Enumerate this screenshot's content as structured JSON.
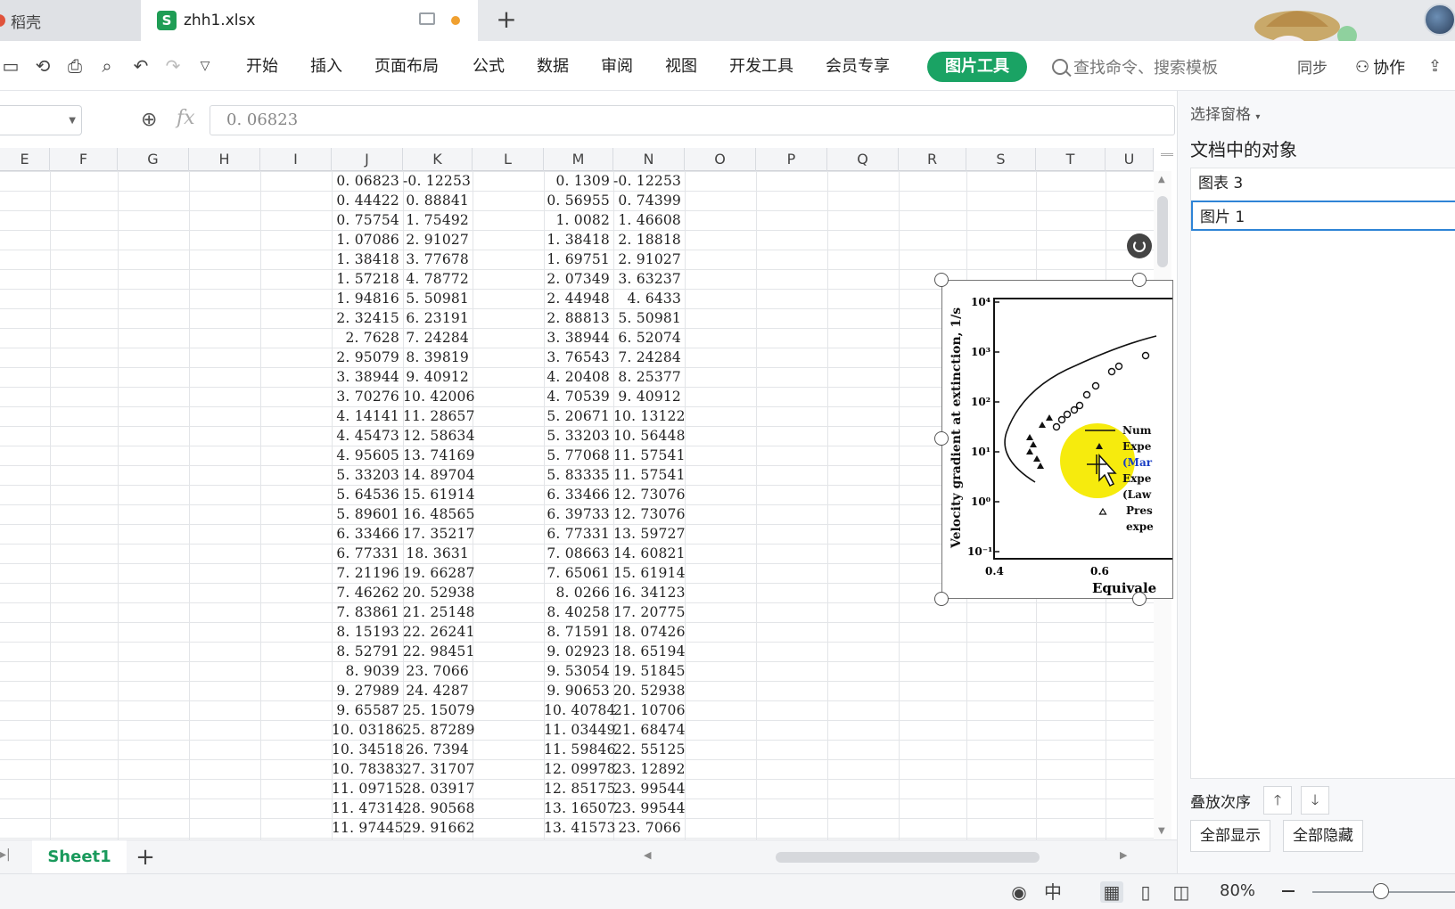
{
  "tabs": {
    "other_tab": "稻壳",
    "file_tab": "zhh1.xlsx",
    "file_badge": "S"
  },
  "ribbon": {
    "menu": [
      "开始",
      "插入",
      "页面布局",
      "公式",
      "数据",
      "审阅",
      "视图",
      "开发工具",
      "会员专享"
    ],
    "active_tool": "图片工具",
    "search_placeholder": "查找命令、搜索模板",
    "sync_label": "同步",
    "collab_label": "协作"
  },
  "formula_bar": {
    "fx_label": "fx",
    "value": "0. 06823"
  },
  "columns": [
    "E",
    "F",
    "G",
    "H",
    "I",
    "J",
    "K",
    "L",
    "M",
    "N",
    "O",
    "P",
    "Q",
    "R",
    "S",
    "T",
    "U"
  ],
  "table": {
    "J": [
      "0. 06823",
      "0. 44422",
      "0. 75754",
      "1. 07086",
      "1. 38418",
      "1. 57218",
      "1. 94816",
      "2. 32415",
      "2. 7628",
      "2. 95079",
      "3. 38944",
      "3. 70276",
      "4. 14141",
      "4. 45473",
      "4. 95605",
      "5. 33203",
      "5. 64536",
      "5. 89601",
      "6. 33466",
      "6. 77331",
      "7. 21196",
      "7. 46262",
      "7. 83861",
      "8. 15193",
      "8. 52791",
      "8. 9039",
      "9. 27989",
      "9. 65587",
      "10. 03186",
      "10. 34518",
      "10. 78383",
      "11. 09715",
      "11. 47314",
      "11. 97445"
    ],
    "K": [
      "-0. 12253",
      "0. 88841",
      "1. 75492",
      "2. 91027",
      "3. 77678",
      "4. 78772",
      "5. 50981",
      "6. 23191",
      "7. 24284",
      "8. 39819",
      "9. 40912",
      "10. 42006",
      "11. 28657",
      "12. 58634",
      "13. 74169",
      "14. 89704",
      "15. 61914",
      "16. 48565",
      "17. 35217",
      "18. 3631",
      "19. 66287",
      "20. 52938",
      "21. 25148",
      "22. 26241",
      "22. 98451",
      "23. 7066",
      "24. 4287",
      "25. 15079",
      "25. 87289",
      "26. 7394",
      "27. 31707",
      "28. 03917",
      "28. 90568",
      "29. 91662"
    ],
    "M": [
      "0. 1309",
      "0. 56955",
      "1. 0082",
      "1. 38418",
      "1. 69751",
      "2. 07349",
      "2. 44948",
      "2. 88813",
      "3. 38944",
      "3. 76543",
      "4. 20408",
      "4. 70539",
      "5. 20671",
      "5. 33203",
      "5. 77068",
      "5. 83335",
      "6. 33466",
      "6. 39733",
      "6. 77331",
      "7. 08663",
      "7. 65061",
      "8. 0266",
      "8. 40258",
      "8. 71591",
      "9. 02923",
      "9. 53054",
      "9. 90653",
      "10. 40784",
      "11. 03449",
      "11. 59846",
      "12. 09978",
      "12. 85175",
      "13. 16507",
      "13. 41573"
    ],
    "N": [
      "-0. 12253",
      "0. 74399",
      "1. 46608",
      "2. 18818",
      "2. 91027",
      "3. 63237",
      "4. 6433",
      "5. 50981",
      "6. 52074",
      "7. 24284",
      "8. 25377",
      "9. 40912",
      "10. 13122",
      "10. 56448",
      "11. 57541",
      "11. 57541",
      "12. 73076",
      "12. 73076",
      "13. 59727",
      "14. 60821",
      "15. 61914",
      "16. 34123",
      "17. 20775",
      "18. 07426",
      "18. 65194",
      "19. 51845",
      "20. 52938",
      "21. 10706",
      "21. 68474",
      "22. 55125",
      "23. 12892",
      "23. 99544",
      "23. 99544",
      "23. 7066"
    ]
  },
  "picture": {
    "ylabel": "Velocity gradient at extinction, 1/s",
    "yticks": [
      "10⁴",
      "10³",
      "10²",
      "10¹",
      "10⁰",
      "10⁻¹"
    ],
    "xticks": [
      "0.4",
      "0.6"
    ],
    "xlabel": "Equivale",
    "legend": [
      "Num",
      "Expe",
      "(Mar",
      "Expe",
      "(Law",
      "Pres",
      "expe"
    ]
  },
  "right_pane": {
    "title": "选择窗格",
    "heading": "文档中的对象",
    "objects": [
      "图表 3",
      "图片 1"
    ],
    "order_label": "叠放次序",
    "show_all": "全部显示",
    "hide_all": "全部隐藏"
  },
  "sheets": {
    "active": "Sheet1"
  },
  "status": {
    "zoom": "80%"
  },
  "colors": {
    "accent_green": "#1aa364",
    "selection_blue": "#2f84d6",
    "highlight_yellow": "#f5ea00"
  }
}
